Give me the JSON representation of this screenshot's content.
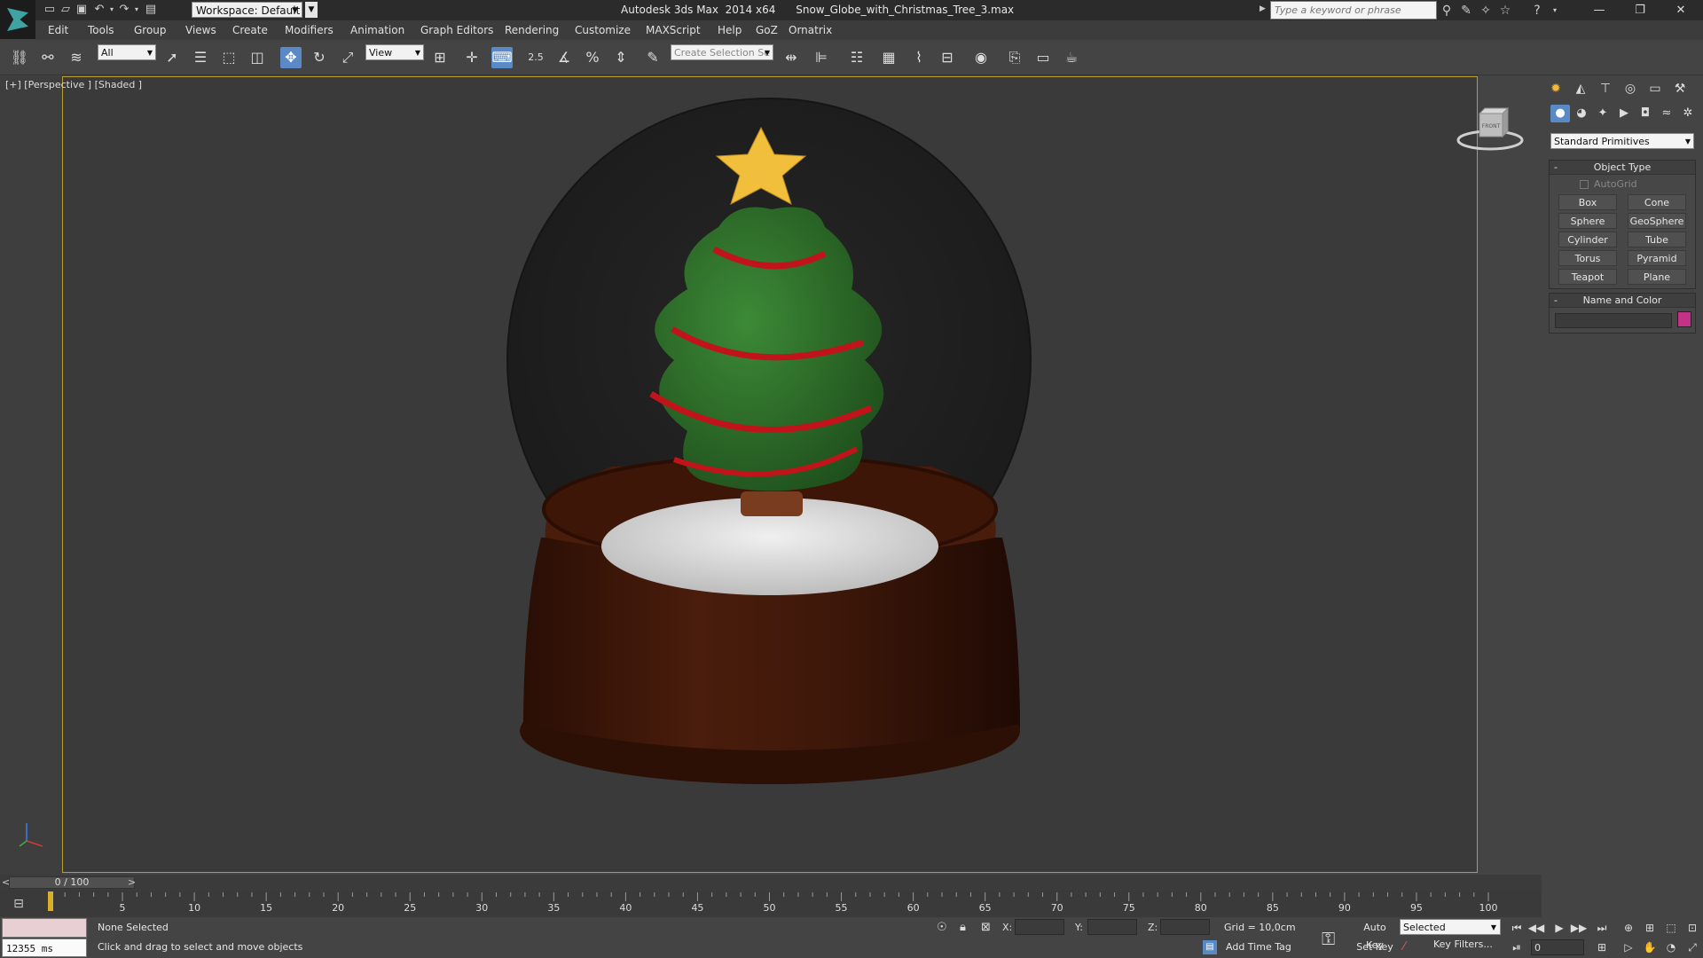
{
  "app": {
    "title": "Autodesk 3ds Max  2014 x64      Snow_Globe_with_Christmas_Tree_3.max",
    "workspace": "Workspace: Default"
  },
  "search": {
    "placeholder": "Type a keyword or phrase"
  },
  "menu": [
    "Edit",
    "Tools",
    "Group",
    "Views",
    "Create",
    "Modifiers",
    "Animation",
    "Graph Editors",
    "Rendering",
    "Customize",
    "MAXScript",
    "Help",
    "GoZ",
    "Ornatrix"
  ],
  "toolbar": {
    "selection_filter": "All",
    "ref_coord": "View",
    "snap_value": "2.5",
    "selection_set_placeholder": "Create Selection Se"
  },
  "viewport": {
    "label": "[+] [Perspective ] [Shaded ]",
    "viewcube_face": "FRONT",
    "border_color": "#b99d2b"
  },
  "command_panel": {
    "category": "Standard Primitives",
    "object_type": {
      "title": "Object Type",
      "autogrid": "AutoGrid",
      "buttons": [
        "Box",
        "Cone",
        "Sphere",
        "GeoSphere",
        "Cylinder",
        "Tube",
        "Torus",
        "Pyramid",
        "Teapot",
        "Plane"
      ]
    },
    "name_and_color": {
      "title": "Name and Color",
      "color": "#c43288"
    }
  },
  "timeline": {
    "slider_label": "0 / 100",
    "prev": "<",
    "next": ">",
    "ticks": [
      "5",
      "10",
      "15",
      "20",
      "25",
      "30",
      "35",
      "40",
      "45",
      "50",
      "55",
      "60",
      "65",
      "70",
      "75",
      "80",
      "85",
      "90",
      "95",
      "100"
    ]
  },
  "status": {
    "time_ms": "12355 ms",
    "selection": "None Selected",
    "prompt": "Click and drag to select and move objects",
    "x_label": "X:",
    "y_label": "Y:",
    "z_label": "Z:",
    "grid": "Grid = 10,0cm",
    "add_time_tag": "Add Time Tag",
    "auto_key": "Auto Key",
    "set_key": "Set Key",
    "key_mode": "Selected",
    "key_filters": "Key Filters...",
    "current_frame": "0"
  }
}
